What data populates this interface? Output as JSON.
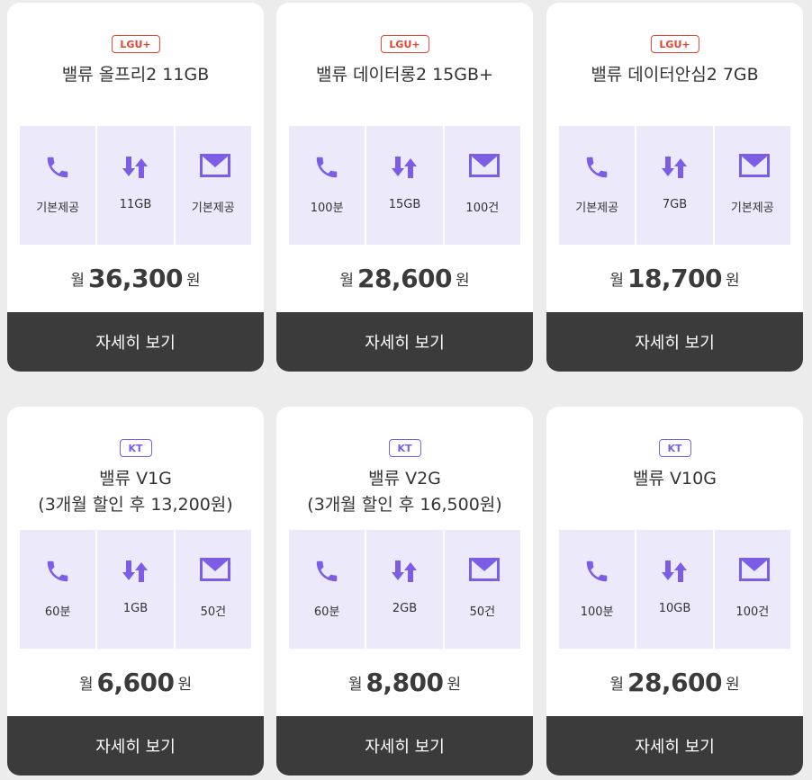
{
  "colors": {
    "accent": "#7b5de6",
    "lgu": "#e4422f",
    "kt": "#7b5de6",
    "feature_bg": "#ece9fb",
    "button_bg": "#3b3b3b"
  },
  "icons": {
    "call": "phone-icon",
    "data": "data-transfer-icon",
    "sms": "mail-icon"
  },
  "common": {
    "price_prefix": "월",
    "price_suffix": "원",
    "detail_label": "자세히 보기"
  },
  "plans": [
    {
      "carrier": "LGU+",
      "name": "밸류 올프리2 11GB",
      "call": "기본제공",
      "data": "11GB",
      "sms": "기본제공",
      "price": "36,300"
    },
    {
      "carrier": "LGU+",
      "name": "밸류 데이터롱2 15GB+",
      "call": "100분",
      "data": "15GB",
      "sms": "100건",
      "price": "28,600"
    },
    {
      "carrier": "LGU+",
      "name": "밸류 데이터안심2 7GB",
      "call": "기본제공",
      "data": "7GB",
      "sms": "기본제공",
      "price": "18,700"
    },
    {
      "carrier": "KT",
      "name": "밸류 V1G\n(3개월 할인 후 13,200원)",
      "call": "60분",
      "data": "1GB",
      "sms": "50건",
      "price": "6,600"
    },
    {
      "carrier": "KT",
      "name": "밸류 V2G\n(3개월 할인 후 16,500원)",
      "call": "60분",
      "data": "2GB",
      "sms": "50건",
      "price": "8,800"
    },
    {
      "carrier": "KT",
      "name": "밸류 V10G",
      "call": "100분",
      "data": "10GB",
      "sms": "100건",
      "price": "28,600"
    }
  ]
}
